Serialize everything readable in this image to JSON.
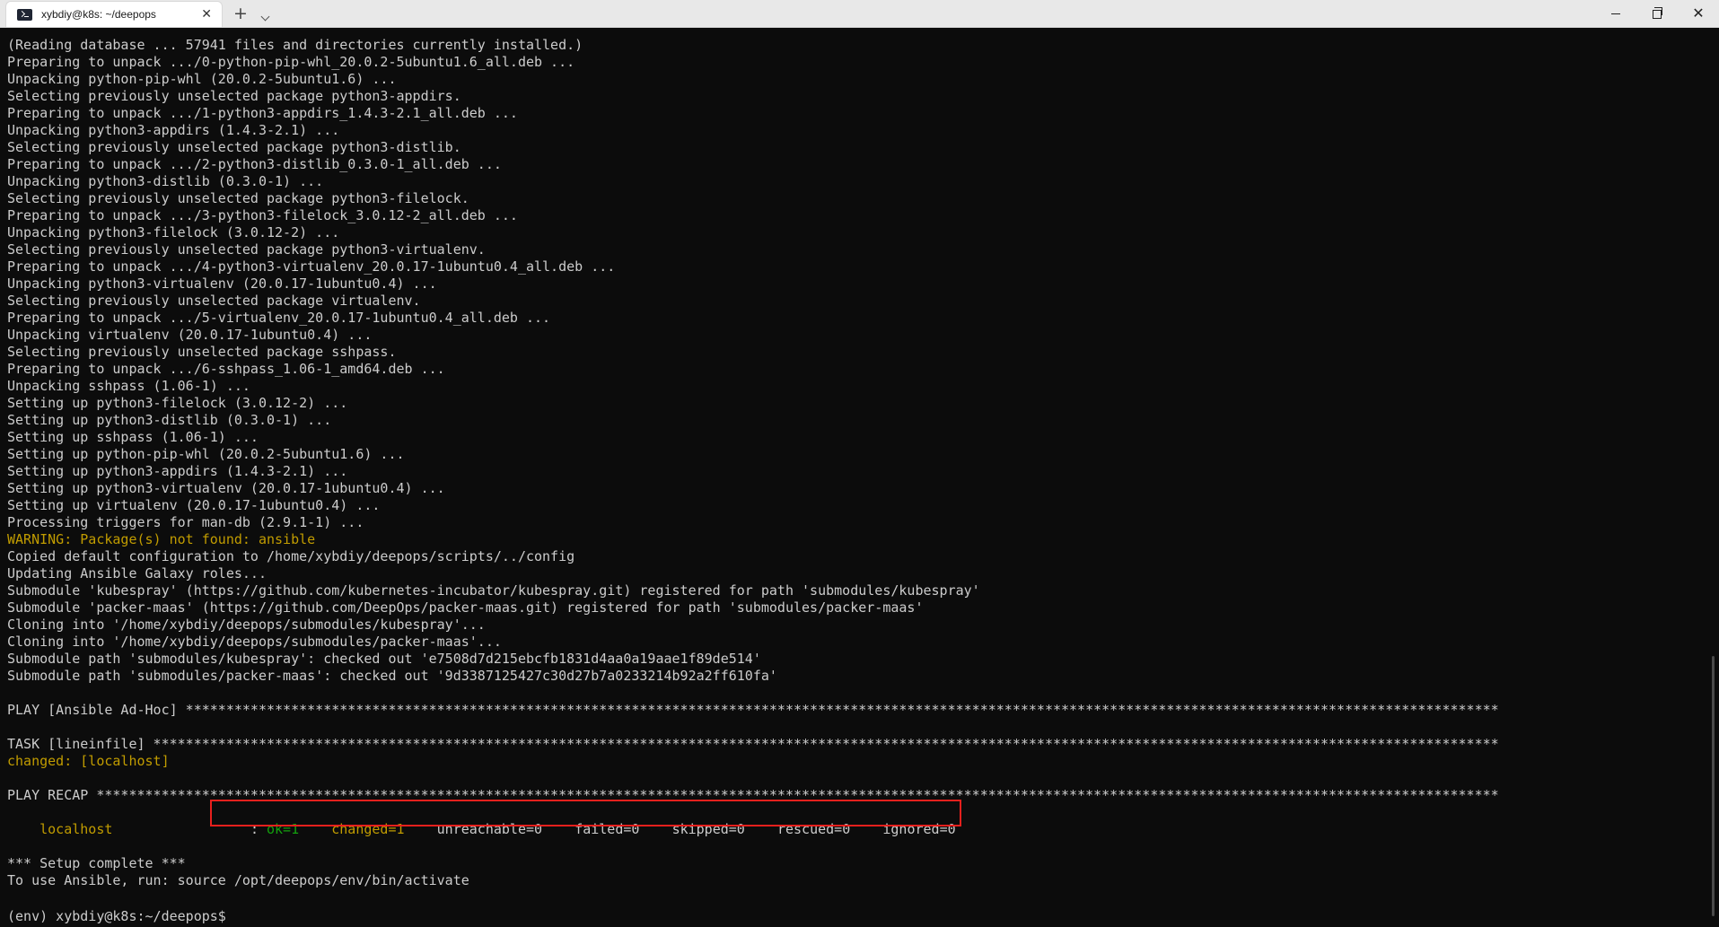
{
  "window": {
    "tab_title": "xybdiy@k8s: ~/deepops",
    "tab_close": "✕",
    "new_tab": "+",
    "minimize": "—",
    "close": "✕"
  },
  "terminal": {
    "lines": [
      "(Reading database ... 57941 files and directories currently installed.)",
      "Preparing to unpack .../0-python-pip-whl_20.0.2-5ubuntu1.6_all.deb ...",
      "Unpacking python-pip-whl (20.0.2-5ubuntu1.6) ...",
      "Selecting previously unselected package python3-appdirs.",
      "Preparing to unpack .../1-python3-appdirs_1.4.3-2.1_all.deb ...",
      "Unpacking python3-appdirs (1.4.3-2.1) ...",
      "Selecting previously unselected package python3-distlib.",
      "Preparing to unpack .../2-python3-distlib_0.3.0-1_all.deb ...",
      "Unpacking python3-distlib (0.3.0-1) ...",
      "Selecting previously unselected package python3-filelock.",
      "Preparing to unpack .../3-python3-filelock_3.0.12-2_all.deb ...",
      "Unpacking python3-filelock (3.0.12-2) ...",
      "Selecting previously unselected package python3-virtualenv.",
      "Preparing to unpack .../4-python3-virtualenv_20.0.17-1ubuntu0.4_all.deb ...",
      "Unpacking python3-virtualenv (20.0.17-1ubuntu0.4) ...",
      "Selecting previously unselected package virtualenv.",
      "Preparing to unpack .../5-virtualenv_20.0.17-1ubuntu0.4_all.deb ...",
      "Unpacking virtualenv (20.0.17-1ubuntu0.4) ...",
      "Selecting previously unselected package sshpass.",
      "Preparing to unpack .../6-sshpass_1.06-1_amd64.deb ...",
      "Unpacking sshpass (1.06-1) ...",
      "Setting up python3-filelock (3.0.12-2) ...",
      "Setting up python3-distlib (0.3.0-1) ...",
      "Setting up sshpass (1.06-1) ...",
      "Setting up python-pip-whl (20.0.2-5ubuntu1.6) ...",
      "Setting up python3-appdirs (1.4.3-2.1) ...",
      "Setting up python3-virtualenv (20.0.17-1ubuntu0.4) ...",
      "Setting up virtualenv (20.0.17-1ubuntu0.4) ...",
      "Processing triggers for man-db (2.9.1-1) ..."
    ],
    "warning_line": "WARNING: Package(s) not found: ansible",
    "lines_after_warning": [
      "Copied default configuration to /home/xybdiy/deepops/scripts/../config",
      "Updating Ansible Galaxy roles...",
      "Submodule 'kubespray' (https://github.com/kubernetes-incubator/kubespray.git) registered for path 'submodules/kubespray'",
      "Submodule 'packer-maas' (https://github.com/DeepOps/packer-maas.git) registered for path 'submodules/packer-maas'",
      "Cloning into '/home/xybdiy/deepops/submodules/kubespray'...",
      "Cloning into '/home/xybdiy/deepops/submodules/packer-maas'...",
      "Submodule path 'submodules/kubespray': checked out 'e7508d7d215ebcfb1831d4aa0a19aae1f89de514'",
      "Submodule path 'submodules/packer-maas': checked out '9d3387125427c30d27b7a0233214b92a2ff610fa'"
    ],
    "play_line": "PLAY [Ansible Ad-Hoc] ******************************************************************************************************************************************************************",
    "task_line": "TASK [lineinfile] **********************************************************************************************************************************************************************",
    "changed_line": "changed: [localhost]",
    "recap_line": "PLAY RECAP *****************************************************************************************************************************************************************************",
    "recap": {
      "host": "localhost",
      "colon": ": ",
      "ok": "ok=1",
      "changed": "changed=1",
      "unreachable": "unreachable=0",
      "failed": "failed=0",
      "skipped": "skipped=0",
      "rescued": "rescued=0",
      "ignored": "ignored=0"
    },
    "setup_complete": "*** Setup complete ***",
    "activate_hint": "To use Ansible, run: source /opt/deepops/env/bin/activate",
    "prompt": "(env) xybdiy@k8s:~/deepops$ "
  }
}
